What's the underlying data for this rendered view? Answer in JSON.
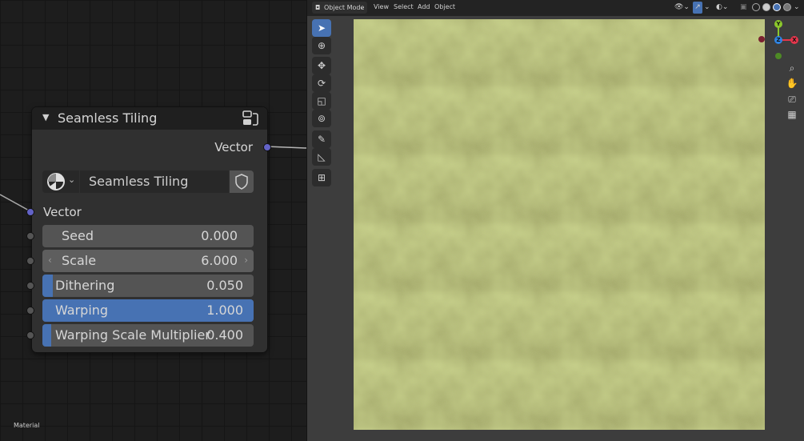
{
  "node_editor": {
    "label": "Material",
    "node": {
      "title": "Seamless Tiling",
      "output_label": "Vector",
      "node_group_name": "Seamless Tiling",
      "input_label": "Vector",
      "fields": [
        {
          "label": "Seed",
          "value": "0.000"
        },
        {
          "label": "Scale",
          "value": "6.000"
        },
        {
          "label": "Dithering",
          "value": "0.050",
          "fill": 0.05
        },
        {
          "label": "Warping",
          "value": "1.000",
          "fill": 1.0
        },
        {
          "label": "Warping Scale Multiplier",
          "value": "0.400",
          "fill": 0.04
        }
      ]
    }
  },
  "viewport": {
    "mode": "Object Mode",
    "menus": [
      "View",
      "Select",
      "Add",
      "Object"
    ],
    "gizmo": {
      "y": "Y",
      "z": "Z",
      "x": "X"
    },
    "colors": {
      "accent": "#4772b3",
      "link_red": "#e04848",
      "socket_vector": "#6363c7",
      "axis_x": "#e5364c",
      "axis_y": "#8bc72c",
      "axis_z": "#2f84e3",
      "texture_base": "#6a7a3c"
    }
  }
}
